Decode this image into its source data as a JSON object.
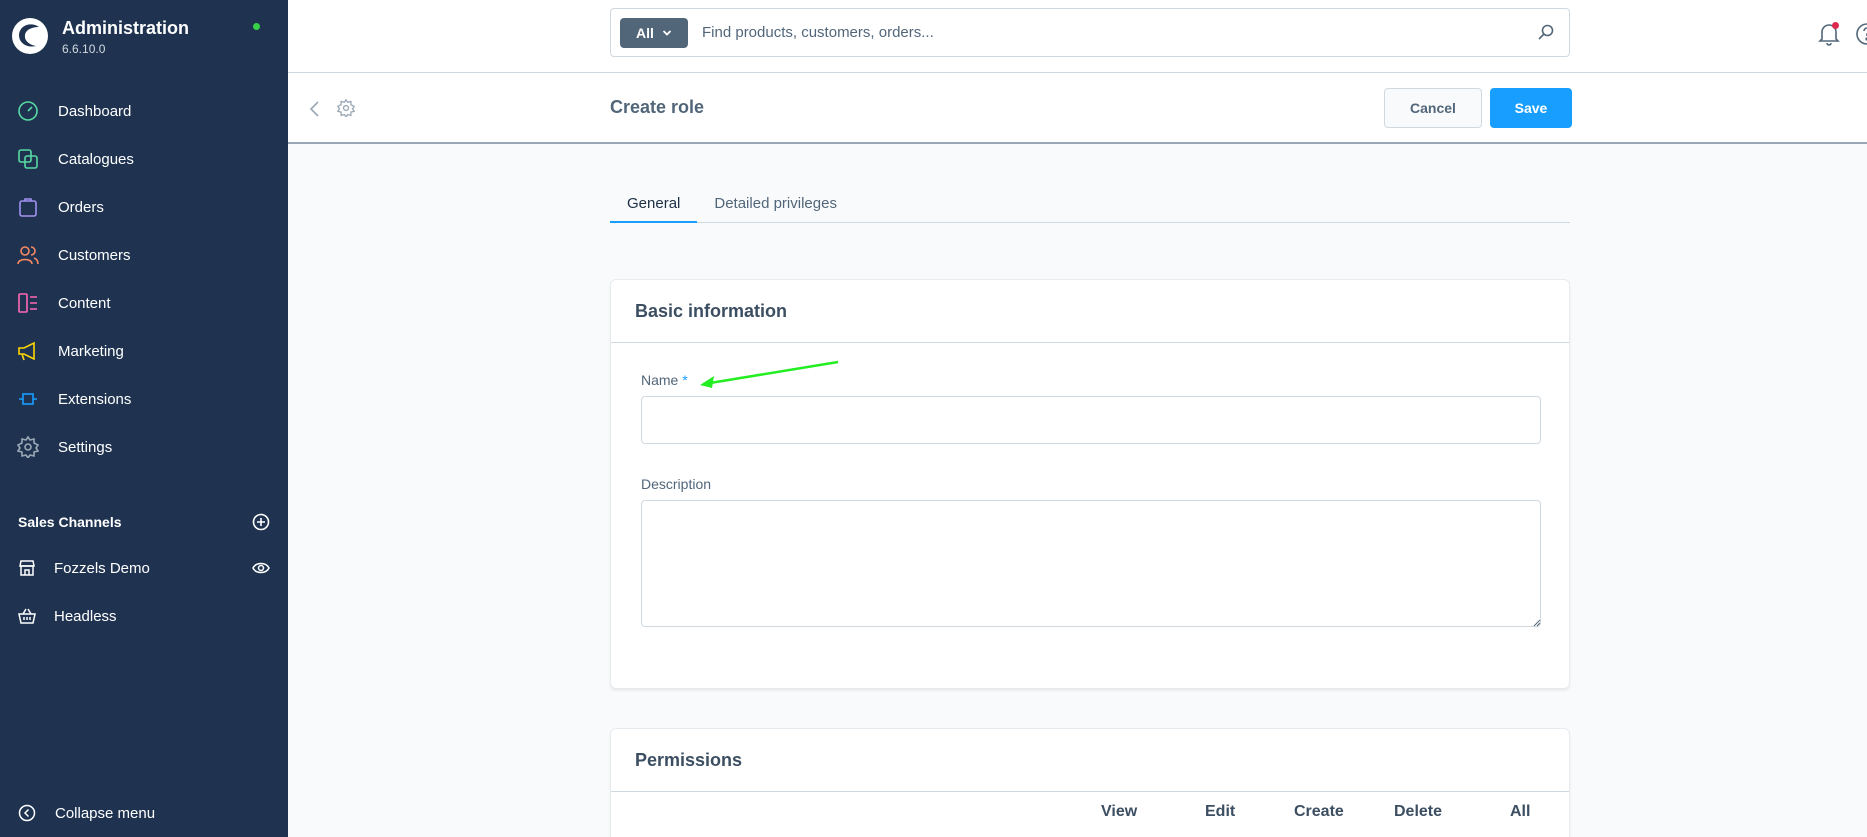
{
  "sidebar": {
    "brand_title": "Administration",
    "brand_version": "6.6.10.0",
    "items": [
      {
        "label": "Dashboard",
        "icon": "dashboard-icon",
        "color": "#57d9a3"
      },
      {
        "label": "Catalogues",
        "icon": "catalogue-icon",
        "color": "#57d9a3"
      },
      {
        "label": "Orders",
        "icon": "orders-icon",
        "color": "#a092f0"
      },
      {
        "label": "Customers",
        "icon": "customers-icon",
        "color": "#f88962"
      },
      {
        "label": "Content",
        "icon": "content-icon",
        "color": "#ff68b4"
      },
      {
        "label": "Marketing",
        "icon": "marketing-icon",
        "color": "#ffd700"
      },
      {
        "label": "Extensions",
        "icon": "extensions-icon",
        "color": "#189eff"
      },
      {
        "label": "Settings",
        "icon": "settings-icon",
        "color": "#9aa8b5"
      }
    ],
    "sales_channels_title": "Sales Channels",
    "sales_channels": [
      {
        "label": "Fozzels Demo",
        "icon": "storefront-icon"
      },
      {
        "label": "Headless",
        "icon": "basket-icon"
      }
    ],
    "collapse_label": "Collapse menu"
  },
  "search": {
    "type_label": "All",
    "placeholder": "Find products, customers, orders..."
  },
  "smartbar": {
    "title": "Create role",
    "cancel_label": "Cancel",
    "save_label": "Save"
  },
  "tabs": [
    {
      "label": "General",
      "active": true
    },
    {
      "label": "Detailed privileges",
      "active": false
    }
  ],
  "basic_info": {
    "title": "Basic information",
    "name_label": "Name",
    "required_marker": "*",
    "name_value": "",
    "description_label": "Description",
    "description_value": ""
  },
  "permissions": {
    "title": "Permissions",
    "columns": [
      "View",
      "Edit",
      "Create",
      "Delete",
      "All"
    ]
  },
  "colors": {
    "sidebar_bg": "#1f3351",
    "primary": "#189eff",
    "annotation_arrow": "#22ee22"
  }
}
